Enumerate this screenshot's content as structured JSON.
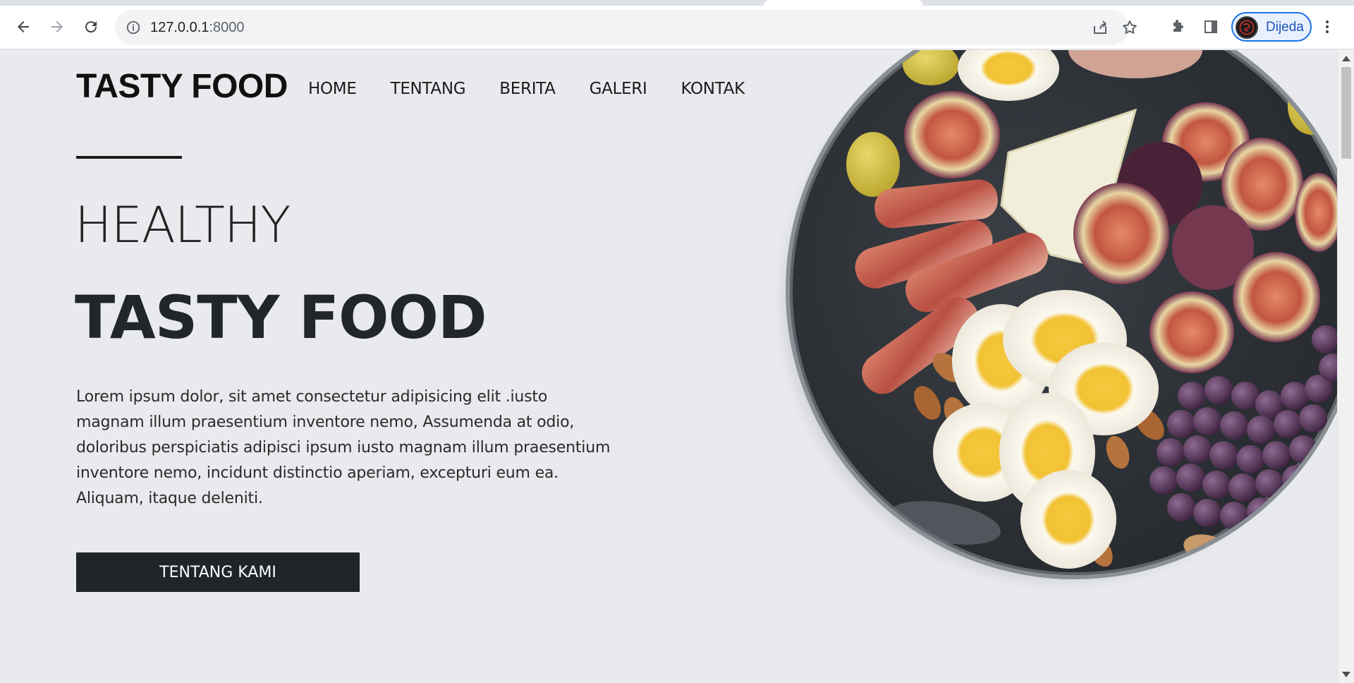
{
  "browser": {
    "url_host": "127.0.0.1",
    "url_port": ":8000",
    "profile_name": "Dijeda",
    "icons": {
      "back": "arrow-left-icon",
      "forward": "arrow-right-icon",
      "reload": "reload-icon",
      "site_info": "info-icon",
      "share": "share-icon",
      "bookmark": "star-icon",
      "extensions": "puzzle-icon",
      "side_panel": "side-panel-icon",
      "menu": "kebab-menu-icon"
    }
  },
  "site": {
    "brand": "TASTY FOOD",
    "nav": [
      "HOME",
      "TENTANG",
      "BERITA",
      "GALERI",
      "KONTAK"
    ],
    "hero": {
      "kicker": "HEALTHY",
      "title": "TASTY FOOD",
      "body": "Lorem ipsum dolor, sit amet consectetur adipisicing elit .iusto magnam illum praesentium inventore nemo, Assumenda at odio, doloribus perspiciatis adipisci ipsum iusto magnam illum praesentium inventore nemo, incidunt distinctio aperiam, excepturi eum ea. Aliquam, itaque deleniti.",
      "cta": "TENTANG KAMI"
    }
  },
  "colors": {
    "page_bg": "#e8eaed",
    "text_dark": "#22262a",
    "button_bg": "#212529",
    "button_text": "#ffffff",
    "chrome_accent": "#1a73e8"
  }
}
